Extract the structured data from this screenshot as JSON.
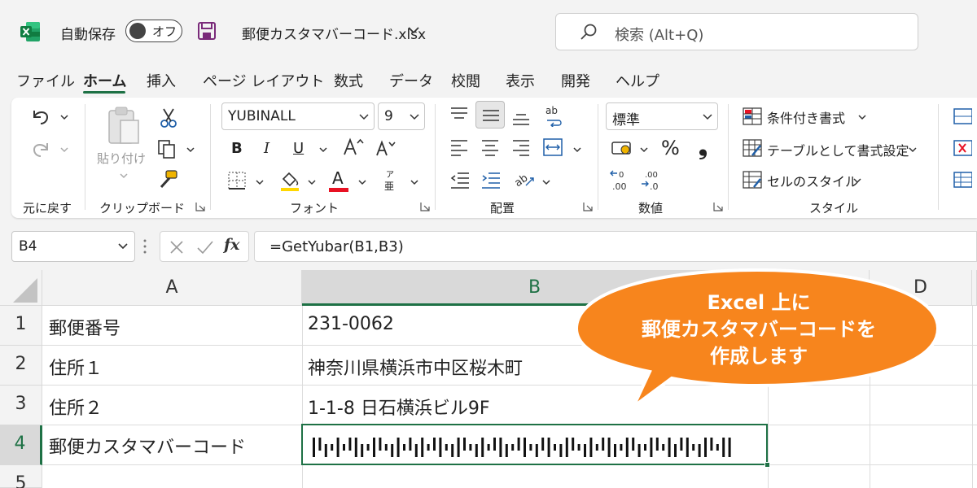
{
  "titlebar": {
    "autosave_label": "自動保存",
    "autosave_state": "オフ",
    "filename": "郵便カスタマバーコード.xlsx",
    "search_placeholder": "検索 (Alt+Q)"
  },
  "menu_tabs": [
    "ファイル",
    "ホーム",
    "挿入",
    "ページ レイアウト",
    "数式",
    "データ",
    "校閲",
    "表示",
    "開発",
    "ヘルプ"
  ],
  "active_tab": "ホーム",
  "ribbon": {
    "groups": {
      "undo": "元に戻す",
      "clipboard": "クリップボード",
      "font": "フォント",
      "alignment": "配置",
      "number": "数値",
      "styles": "スタイル"
    },
    "paste_label": "貼り付け",
    "font_name": "YUBINALL",
    "font_size": "9",
    "number_format": "標準",
    "conditional_format": "条件付き書式",
    "format_as_table": "テーブルとして書式設定",
    "cell_styles": "セルのスタイル",
    "bold": "B",
    "italic": "I",
    "underline": "U",
    "percent": "%",
    "comma": "❟",
    "font_color_letter": "A",
    "font_color": "#e81123",
    "phonetic_top": "ア",
    "phonetic_bottom": "亜"
  },
  "formula_bar": {
    "name_box": "B4",
    "fx": "fx",
    "formula": "=GetYubar(B1,B3)"
  },
  "sheet": {
    "columns": [
      "A",
      "B",
      "D"
    ],
    "rows": [
      "1",
      "2",
      "3",
      "4",
      "5"
    ],
    "cells": {
      "A1": "郵便番号",
      "B1": "231-0062",
      "A2": "住所１",
      "B2": "神奈川県横浜市中区桜木町",
      "A3": "住所２",
      "B3": "1-1-8 日石横浜ビル9F",
      "A4": "郵便カスタマバーコード"
    },
    "selected_cell": "B4",
    "accent": "#1e7145"
  },
  "callout": {
    "lines": [
      "Excel 上に",
      "郵便カスタマバーコードを",
      "作成します"
    ],
    "fill": "#f7851d"
  }
}
